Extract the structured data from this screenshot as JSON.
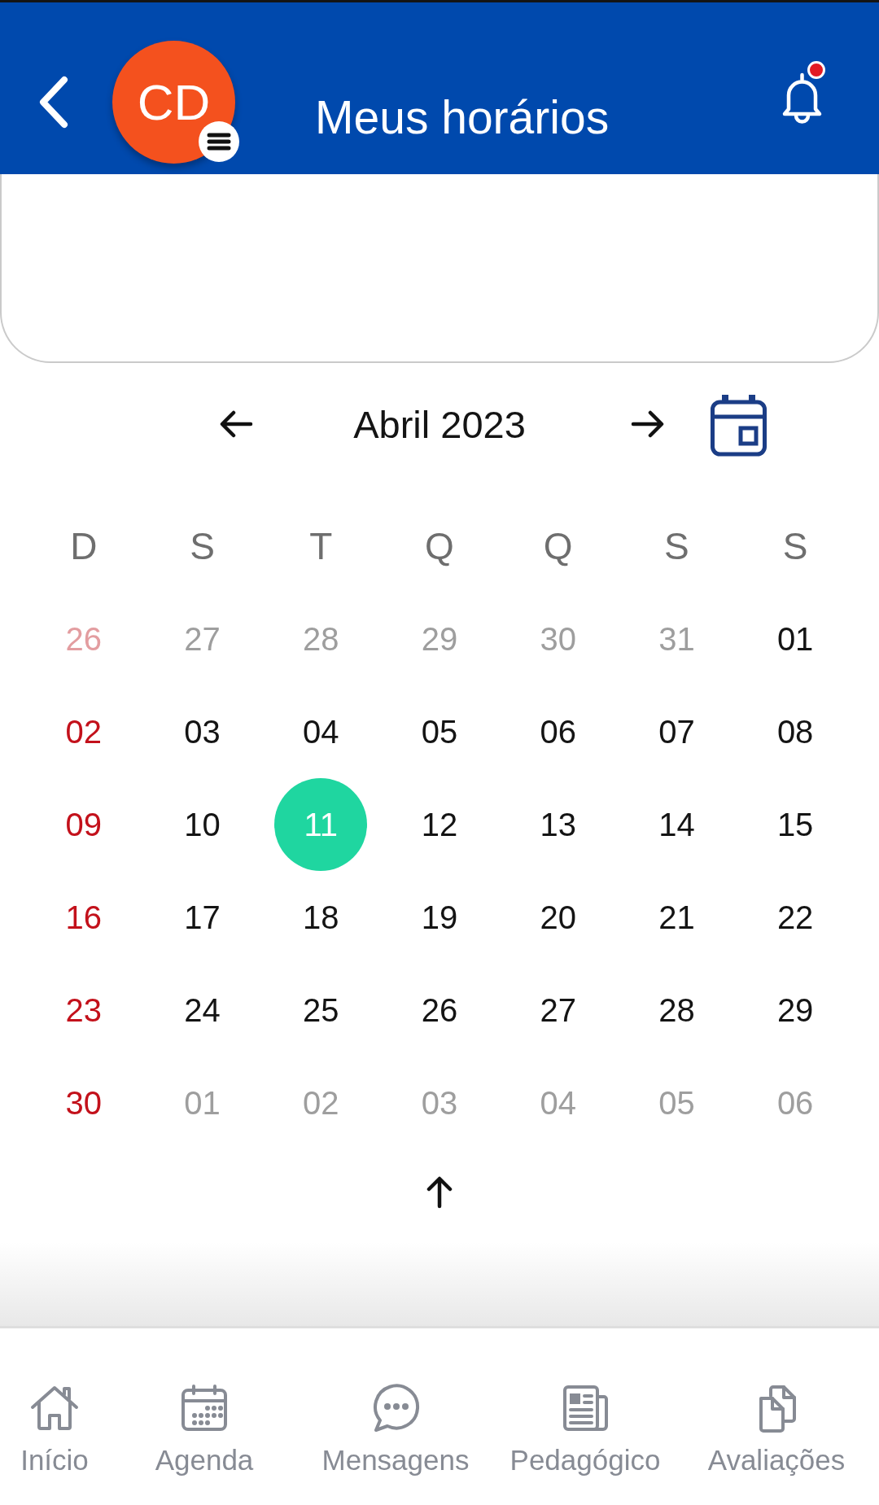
{
  "header": {
    "title": "Meus horários",
    "avatar_initials": "CD",
    "notification_dot": true
  },
  "month_nav": {
    "title": "Abril 2023"
  },
  "calendar": {
    "weekdays": [
      "D",
      "S",
      "T",
      "Q",
      "Q",
      "S",
      "S"
    ],
    "weeks": [
      {
        "days": [
          {
            "label": "26",
            "other_month": true,
            "selected": false
          },
          {
            "label": "27",
            "other_month": true,
            "selected": false
          },
          {
            "label": "28",
            "other_month": true,
            "selected": false
          },
          {
            "label": "29",
            "other_month": true,
            "selected": false
          },
          {
            "label": "30",
            "other_month": true,
            "selected": false
          },
          {
            "label": "31",
            "other_month": true,
            "selected": false
          },
          {
            "label": "01",
            "other_month": false,
            "selected": false
          }
        ]
      },
      {
        "days": [
          {
            "label": "02",
            "other_month": false,
            "selected": false
          },
          {
            "label": "03",
            "other_month": false,
            "selected": false
          },
          {
            "label": "04",
            "other_month": false,
            "selected": false
          },
          {
            "label": "05",
            "other_month": false,
            "selected": false
          },
          {
            "label": "06",
            "other_month": false,
            "selected": false
          },
          {
            "label": "07",
            "other_month": false,
            "selected": false
          },
          {
            "label": "08",
            "other_month": false,
            "selected": false
          }
        ]
      },
      {
        "days": [
          {
            "label": "09",
            "other_month": false,
            "selected": false
          },
          {
            "label": "10",
            "other_month": false,
            "selected": false
          },
          {
            "label": "11",
            "other_month": false,
            "selected": true
          },
          {
            "label": "12",
            "other_month": false,
            "selected": false
          },
          {
            "label": "13",
            "other_month": false,
            "selected": false
          },
          {
            "label": "14",
            "other_month": false,
            "selected": false
          },
          {
            "label": "15",
            "other_month": false,
            "selected": false
          }
        ]
      },
      {
        "days": [
          {
            "label": "16",
            "other_month": false,
            "selected": false
          },
          {
            "label": "17",
            "other_month": false,
            "selected": false
          },
          {
            "label": "18",
            "other_month": false,
            "selected": false
          },
          {
            "label": "19",
            "other_month": false,
            "selected": false
          },
          {
            "label": "20",
            "other_month": false,
            "selected": false
          },
          {
            "label": "21",
            "other_month": false,
            "selected": false
          },
          {
            "label": "22",
            "other_month": false,
            "selected": false
          }
        ]
      },
      {
        "days": [
          {
            "label": "23",
            "other_month": false,
            "selected": false
          },
          {
            "label": "24",
            "other_month": false,
            "selected": false
          },
          {
            "label": "25",
            "other_month": false,
            "selected": false
          },
          {
            "label": "26",
            "other_month": false,
            "selected": false
          },
          {
            "label": "27",
            "other_month": false,
            "selected": false
          },
          {
            "label": "28",
            "other_month": false,
            "selected": false
          },
          {
            "label": "29",
            "other_month": false,
            "selected": false
          }
        ]
      },
      {
        "days": [
          {
            "label": "30",
            "other_month": false,
            "selected": false
          },
          {
            "label": "01",
            "other_month": true,
            "selected": false
          },
          {
            "label": "02",
            "other_month": true,
            "selected": false
          },
          {
            "label": "03",
            "other_month": true,
            "selected": false
          },
          {
            "label": "04",
            "other_month": true,
            "selected": false
          },
          {
            "label": "05",
            "other_month": true,
            "selected": false
          },
          {
            "label": "06",
            "other_month": true,
            "selected": false
          }
        ]
      }
    ]
  },
  "bottom_nav": {
    "items": [
      {
        "kind": "home",
        "label": "Início",
        "selected": false
      },
      {
        "kind": "agenda",
        "label": "Agenda",
        "selected": false
      },
      {
        "kind": "messages",
        "label": "Mensagens",
        "selected": false
      },
      {
        "kind": "pedagogic",
        "label": "Pedagógico",
        "selected": false
      },
      {
        "kind": "evaluations",
        "label": "Avaliações",
        "selected": false
      }
    ]
  }
}
